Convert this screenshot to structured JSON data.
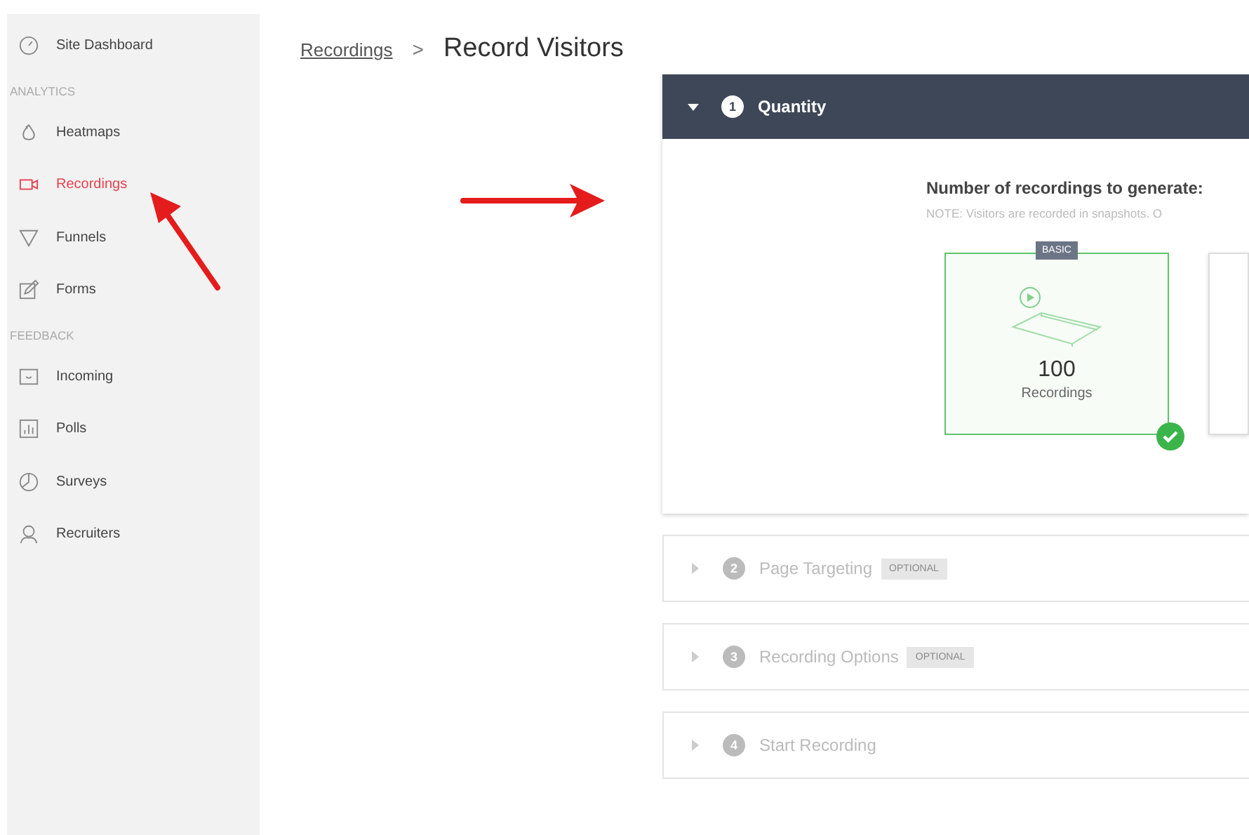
{
  "sidebar": {
    "items": [
      {
        "kind": "item",
        "label": "Site Dashboard",
        "selected": false
      },
      {
        "kind": "header",
        "label": "ANALYTICS"
      },
      {
        "kind": "item",
        "label": "Heatmaps",
        "selected": false
      },
      {
        "kind": "item",
        "label": "Recordings",
        "selected": true
      },
      {
        "kind": "item",
        "label": "Funnels",
        "selected": false
      },
      {
        "kind": "item",
        "label": "Forms",
        "selected": false
      },
      {
        "kind": "header",
        "label": "FEEDBACK"
      },
      {
        "kind": "item",
        "label": "Incoming",
        "selected": false
      },
      {
        "kind": "item",
        "label": "Polls",
        "selected": false
      },
      {
        "kind": "item",
        "label": "Surveys",
        "selected": false
      },
      {
        "kind": "item",
        "label": "Recruiters",
        "selected": false
      }
    ]
  },
  "breadcrumb": {
    "link": "Recordings",
    "separator": ">",
    "current": "Record Visitors"
  },
  "steps": [
    {
      "number": "1",
      "title": "Quantity",
      "expanded": true
    },
    {
      "number": "2",
      "title": "Page Targeting",
      "badge": "OPTIONAL",
      "expanded": false
    },
    {
      "number": "3",
      "title": "Recording Options",
      "badge": "OPTIONAL",
      "expanded": false
    },
    {
      "number": "4",
      "title": "Start Recording",
      "expanded": false
    }
  ],
  "quantity": {
    "heading": "Number of recordings to generate:",
    "note": "NOTE: Visitors are recorded in snapshots. O",
    "options": [
      {
        "badge": "BASIC",
        "value": "100",
        "label": "Recordings",
        "selected": true
      },
      {
        "selected": false
      }
    ]
  }
}
